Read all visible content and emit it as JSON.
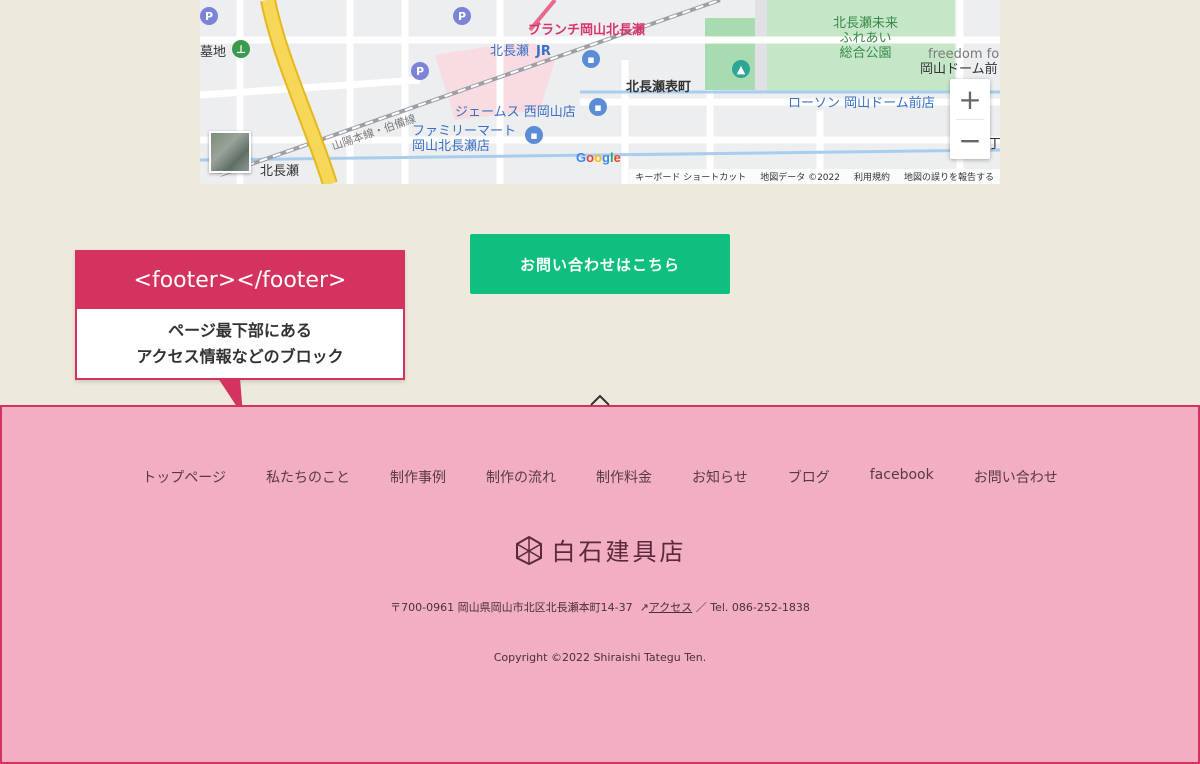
{
  "map": {
    "labels": {
      "station_shop": "ブランチ岡山北長瀬",
      "station": "北長瀬",
      "station_mark": "JR",
      "park": "北長瀬未来\nふれあい\n総合公園",
      "freedom": "freedom fo",
      "okayama_dome": "岡山ドーム前",
      "town": "北長瀬表町",
      "james": "ジェームス 西岡山店",
      "familymart": "ファミリーマート\n岡山北長瀬店",
      "lawson": "ローソン 岡山ドーム前店",
      "rail": "山陽本線・伯備線",
      "grave": "墓地",
      "kitanagase_bottom": "北長瀬",
      "edge_char": "丁"
    },
    "zoom_in": "+",
    "zoom_out": "−",
    "google": "Google",
    "attribution": [
      "キーボード ショートカット",
      "地図データ ©2022",
      "利用規約",
      "地図の誤りを報告する"
    ]
  },
  "cta": {
    "label": "お問い合わせはこちら"
  },
  "callout": {
    "title": "<footer></footer>",
    "line1": "ページ最下部にある",
    "line2": "アクセス情報などのブロック"
  },
  "footer": {
    "nav": [
      "トップページ",
      "私たちのこと",
      "制作事例",
      "制作の流れ",
      "制作料金",
      "お知らせ",
      "ブログ",
      "facebook",
      "お問い合わせ"
    ],
    "brand": "白石建具店",
    "address_prefix": "〒700-0961 岡山県岡山市北区北長瀬本町14-37",
    "access_link": "アクセス",
    "address_suffix": "／ Tel. 086-252-1838",
    "copyright": "Copyright ©2022 Shiraishi Tategu Ten."
  },
  "colors": {
    "background": "#edeadb",
    "accent": "#d4325f",
    "footer_bg": "#f2aec2",
    "cta": "#0ebf7d"
  }
}
